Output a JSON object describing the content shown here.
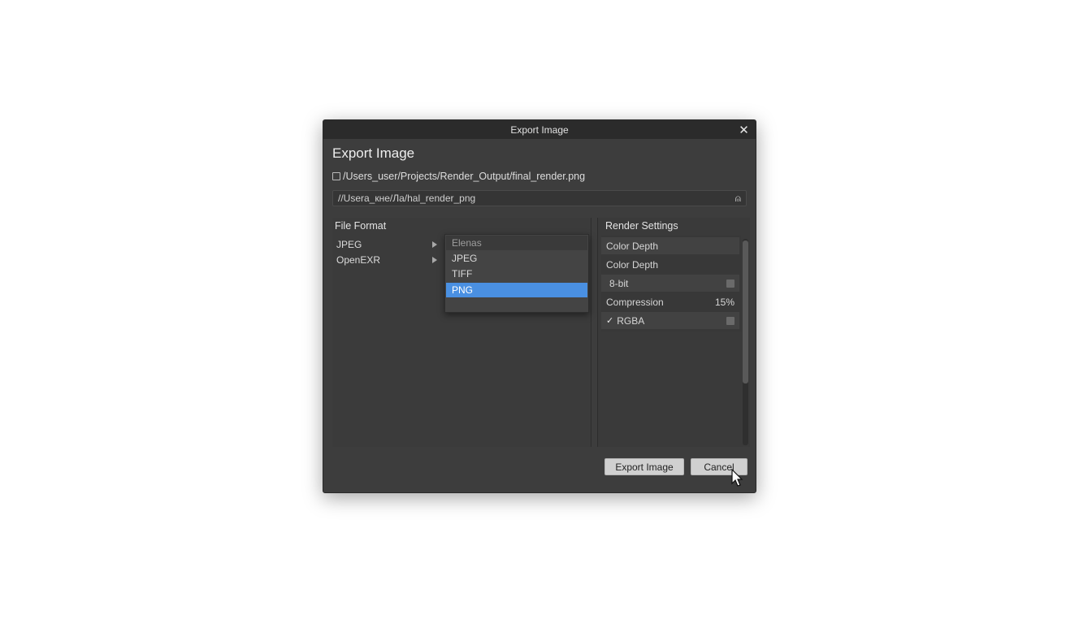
{
  "window": {
    "title": "Export Image"
  },
  "heading": "Export Image",
  "file_path": "/Users_user/Projects/Render_Output/final_render.png",
  "path_input": {
    "value": "//Usera_кне/Ла/hal_render_png"
  },
  "file_format": {
    "title": "File Format",
    "items": [
      {
        "label": "JPEG"
      },
      {
        "label": "OpenEXR"
      }
    ]
  },
  "dropdown": {
    "header": "Elenas",
    "options": [
      "JPEG",
      "TIFF",
      "PNG"
    ],
    "selected": "PNG"
  },
  "render_settings": {
    "title": "Render Settings",
    "rows": [
      {
        "label": "Color Depth"
      },
      {
        "label": "Color Depth"
      },
      {
        "label": "8-bit"
      },
      {
        "label": "Compression",
        "value": "15%"
      },
      {
        "label": "RGBA",
        "checked": true
      }
    ]
  },
  "buttons": {
    "export": "Export Image",
    "cancel": "Cancel"
  },
  "icons": {
    "close": "close-icon",
    "browse": "browse-icon",
    "file": "file-icon",
    "arrow": "chevron-right-icon"
  },
  "colors": {
    "accent": "#4a90e2",
    "dialog_bg": "#3d3d3d",
    "titlebar_bg": "#2b2b2b"
  }
}
